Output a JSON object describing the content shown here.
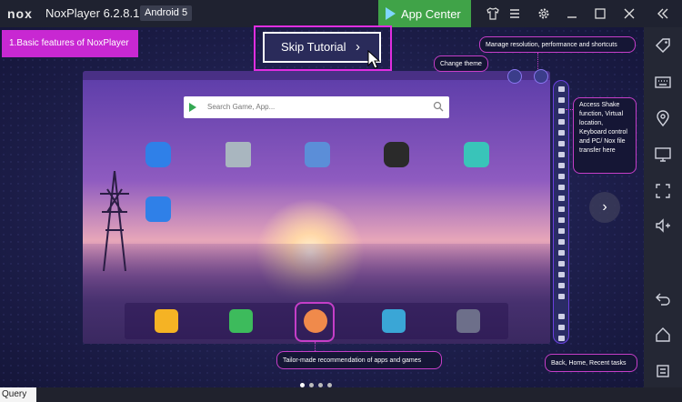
{
  "titlebar": {
    "logo": "nox",
    "title": "NoxPlayer 6.2.8.1",
    "android": "Android 5",
    "app_center": "App Center",
    "icons": [
      "shirt-icon",
      "menu-icon",
      "gear-icon",
      "minimize-icon",
      "maximize-icon",
      "close-icon",
      "collapse-icon"
    ]
  },
  "tutorial": {
    "feature_tag": "1.Basic features of NoxPlayer",
    "skip_label": "Skip Tutorial",
    "skip_chevron": "›"
  },
  "emulator": {
    "search_placeholder": "Search Game, App..."
  },
  "tips": {
    "manage": "Manage resolution, performance and shortcuts",
    "theme": "Change theme",
    "shake": "Access Shake function, Virtual location, Keyboard control and PC/ Nox file transfer here",
    "recommend": "Tailor-made recommendation of apps and games",
    "nav": "Back, Home, Recent tasks"
  },
  "bottom": {
    "query": "Query"
  },
  "sidebar_icons": [
    "tag-icon",
    "keyboard-icon",
    "location-icon",
    "screen-icon",
    "fullscreen-icon",
    "volume-icon",
    "back-icon",
    "home-icon",
    "recent-icon"
  ],
  "colors": {
    "accent": "#c828d2",
    "app_center": "#40a348"
  }
}
